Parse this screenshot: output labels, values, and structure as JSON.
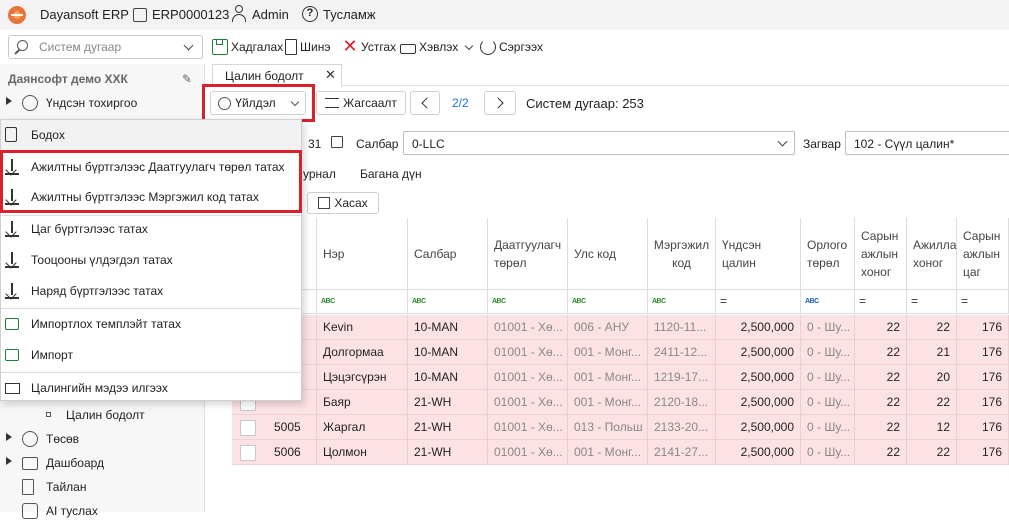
{
  "titlebar": {
    "app": "Dayansoft ERP",
    "db": "ERP0000123",
    "user": "Admin",
    "help": "Тусламж"
  },
  "toolbar": {
    "search_placeholder": "Систем дугаар",
    "save": "Хадгалах",
    "new": "Шинэ",
    "delete": "Устгах",
    "print": "Хэвлэх",
    "refresh": "Сэргээх"
  },
  "sidebar": {
    "company": "Даянсофт демо ХХК",
    "items": [
      {
        "label": "Үндсэн тохиргоо"
      },
      {
        "label": "Цалин бодолт"
      },
      {
        "label": "Төсөв"
      },
      {
        "label": "Дашбоард"
      },
      {
        "label": "Тайлан"
      },
      {
        "label": "AI туслах"
      }
    ]
  },
  "tab": {
    "label": "Цалин бодолт"
  },
  "actions": {
    "operation": "Үйлдэл",
    "order": "Жагсаалт",
    "page": "2/2",
    "sysno": "Систем дугаар: 253"
  },
  "filters": {
    "date_tail": "31",
    "branch_label": "Салбар",
    "branch_value": "0-LLC",
    "template_label": "Загвар",
    "template_value": "102 - Сүүл цалин*",
    "journal_tail": "урнал",
    "col_sum": "Багана дүн",
    "remove": "Хасах"
  },
  "columns": [
    "Нэр",
    "Салбар",
    "Даатгуулагч төрөл",
    "Улс код",
    "Мэргэжил код",
    "Үндсэн цалин",
    "Орлого төрөл",
    "Сарын ажлын хоног",
    "Ажилласан хоног",
    "Сарын ажлын цаг"
  ],
  "rows": [
    {
      "code": "",
      "name": "Kevin",
      "branch": "10-MAN",
      "ins": "01001 - Хө...",
      "country": "006 - АНУ",
      "prof": "1120-11...",
      "salary": "2,500,000",
      "inc": "0 - Шу...",
      "days": "22",
      "worked": "22",
      "hours": "176"
    },
    {
      "code": "",
      "name": "Долгормаа",
      "branch": "10-MAN",
      "ins": "01001 - Хө...",
      "country": "001 - Монг...",
      "prof": "2411-12...",
      "salary": "2,500,000",
      "inc": "0 - Шу...",
      "days": "22",
      "worked": "21",
      "hours": "176"
    },
    {
      "code": "",
      "name": "Цэцэгсүрэн",
      "branch": "10-MAN",
      "ins": "01001 - Хө...",
      "country": "001 - Монг...",
      "prof": "1219-17...",
      "salary": "2,500,000",
      "inc": "0 - Шу...",
      "days": "22",
      "worked": "20",
      "hours": "176"
    },
    {
      "code": "",
      "name": "Баяр",
      "branch": "21-WH",
      "ins": "01001 - Хө...",
      "country": "001 - Монг...",
      "prof": "2120-18...",
      "salary": "2,500,000",
      "inc": "0 - Шу...",
      "days": "22",
      "worked": "22",
      "hours": "176"
    },
    {
      "code": "5005",
      "name": "Жаргал",
      "branch": "21-WH",
      "ins": "01001 - Хө...",
      "country": "013 - Польш",
      "prof": "2133-20...",
      "salary": "2,500,000",
      "inc": "0 - Шу...",
      "days": "22",
      "worked": "12",
      "hours": "176"
    },
    {
      "code": "5006",
      "name": "Цолмон",
      "branch": "21-WH",
      "ins": "01001 - Хө...",
      "country": "001 - Монг...",
      "prof": "2141-27...",
      "salary": "2,500,000",
      "inc": "0 - Шу...",
      "days": "22",
      "worked": "22",
      "hours": "176"
    }
  ],
  "menu": {
    "items": [
      "Бодох",
      "Ажилтны бүртгэлээс Даатгуулагч төрөл татах",
      "Ажилтны бүртгэлээс Мэргэжил код татах",
      "Цаг бүртгэлээс татах",
      "Тооцооны үлдэгдэл татах",
      "Наряд бүртгэлээс татах",
      "Импортлох темплэйт татах",
      "Импорт",
      "Цалингийн мэдээ илгээх"
    ]
  },
  "colors": {
    "row_bg": "#fde2e4",
    "highlight": "#d9202b",
    "accent": "#1a73e8"
  }
}
